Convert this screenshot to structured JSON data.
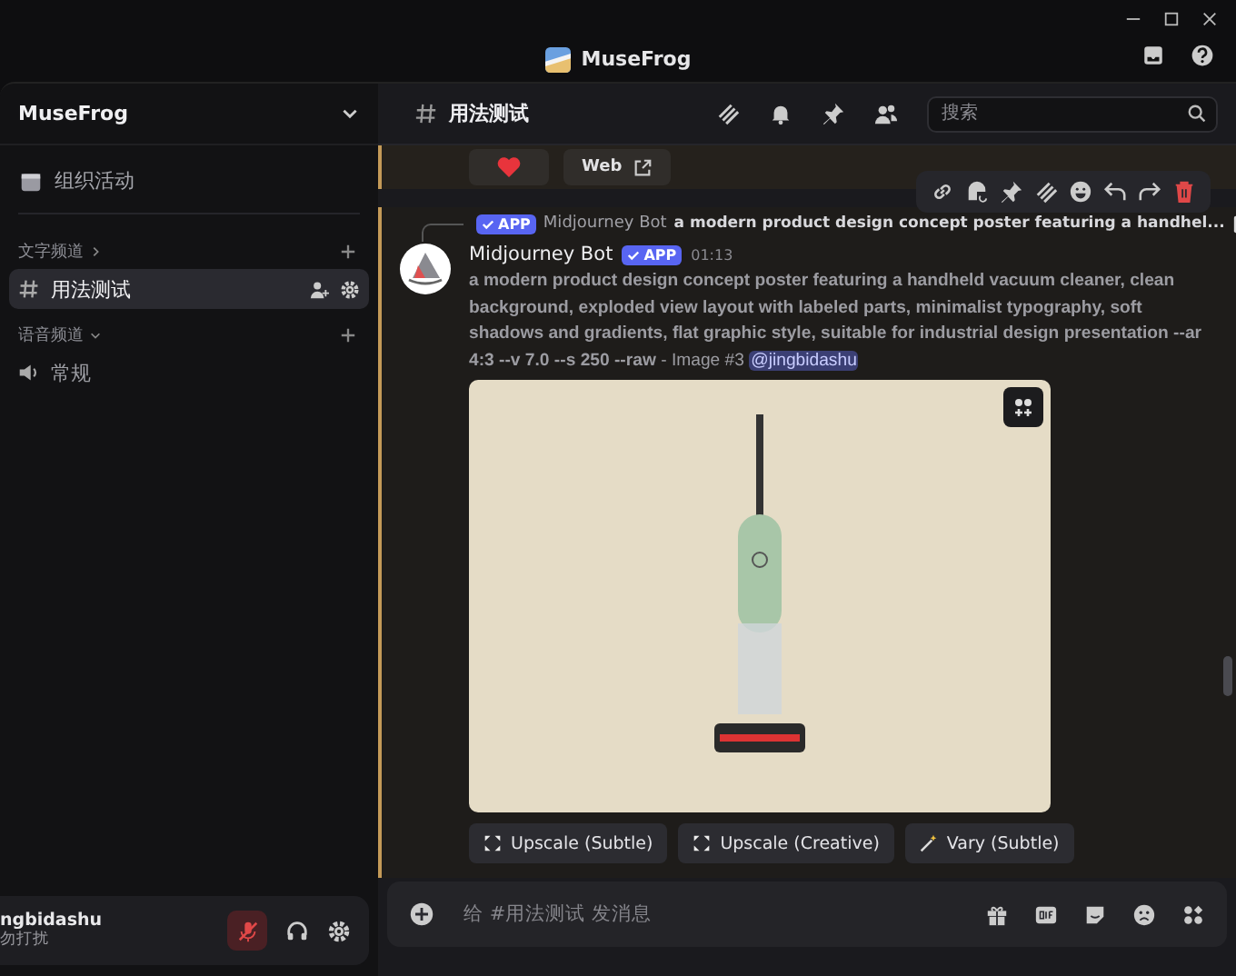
{
  "window": {
    "title": "MuseFrog"
  },
  "sidebar": {
    "server_name": "MuseFrog",
    "items": [
      {
        "label": "组织活动"
      }
    ],
    "categories": [
      {
        "label": "文字频道",
        "kind": "text",
        "channels": [
          {
            "name": "用法测试",
            "selected": true
          }
        ]
      },
      {
        "label": "语音频道",
        "kind": "voice",
        "channels": [
          {
            "name": "常规",
            "selected": false
          }
        ]
      }
    ]
  },
  "user_panel": {
    "name": "ngbidashu",
    "status": "勿打扰",
    "muted": true
  },
  "channel_header": {
    "name": "用法测试",
    "search_placeholder": "搜索"
  },
  "previous_message": {
    "buttons": [
      {
        "kind": "heart"
      },
      {
        "kind": "link",
        "label": "Web"
      }
    ]
  },
  "message": {
    "reply": {
      "badge": "APP",
      "author": "Midjourney Bot",
      "text": "a modern product design concept poster featuring a handhel..."
    },
    "author": "Midjourney Bot",
    "badge": "APP",
    "time": "01:13",
    "text": "**a modern product design concept poster featuring a handheld vacuum cleaner, clean background, exploded view layout with labeled parts, minimalist typography, soft shadows and gradients, flat graphic style, suitable for industrial design presentation --ar 4:3 --v 7.0 --s 250 --raw** - Image #3",
    "mention": "@jingbidashu",
    "actions": [
      {
        "kind": "upscale",
        "label": "Upscale (Subtle)"
      },
      {
        "kind": "upscale",
        "label": "Upscale (Creative)"
      },
      {
        "kind": "vary",
        "label": "Vary (Subtle)"
      }
    ]
  },
  "composer": {
    "placeholder": "给 #用法测试 发消息"
  }
}
